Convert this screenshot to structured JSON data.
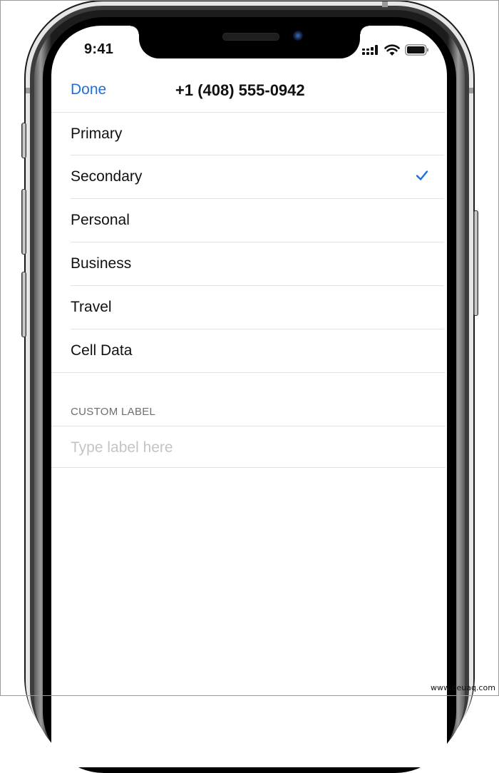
{
  "status_bar": {
    "time": "9:41",
    "icons": [
      "cellular-signal-icon",
      "wifi-icon",
      "battery-icon"
    ]
  },
  "nav": {
    "done_label": "Done",
    "title": "+1 (408) 555-0942"
  },
  "labels": {
    "items": [
      {
        "label": "Primary",
        "selected": false
      },
      {
        "label": "Secondary",
        "selected": true
      },
      {
        "label": "Personal",
        "selected": false
      },
      {
        "label": "Business",
        "selected": false
      },
      {
        "label": "Travel",
        "selected": false
      },
      {
        "label": "Cell Data",
        "selected": false
      }
    ],
    "selected_icon": "checkmark-icon"
  },
  "custom_section": {
    "header": "CUSTOM LABEL",
    "input_value": "",
    "input_placeholder": "Type label here"
  },
  "colors": {
    "accent": "#1e6fe0",
    "text": "#111111",
    "separator": "#e3e3e5",
    "section_header": "#6d6d72",
    "placeholder": "#c4c4c6"
  },
  "watermark": "www.deuaq.com"
}
